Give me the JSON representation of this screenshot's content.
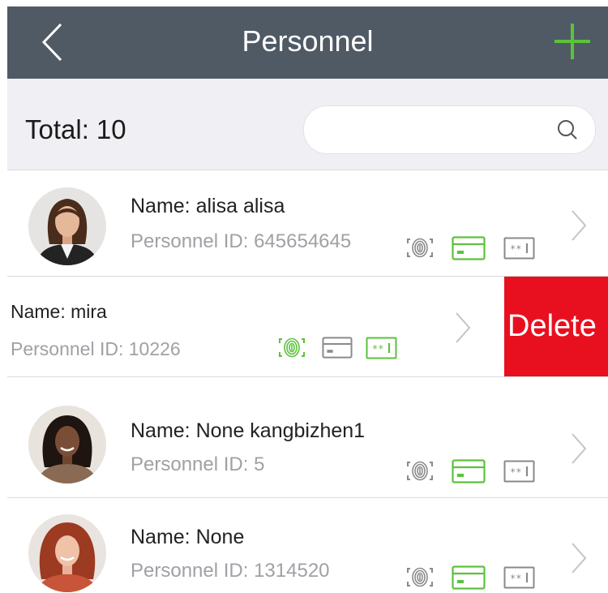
{
  "header": {
    "title": "Personnel",
    "back_icon": "chevron-left-icon",
    "add_icon": "plus-icon"
  },
  "summary": {
    "total_label": "Total:",
    "total_count": "10"
  },
  "search": {
    "placeholder": "",
    "value": "",
    "icon": "search-icon"
  },
  "colors": {
    "nav_bg": "#4f5a65",
    "accent_green": "#5cc23c",
    "delete_red": "#e8101f",
    "muted_text": "#a0a0a6"
  },
  "personnel": [
    {
      "name": "Name: alisa alisa",
      "personnel_id": "Personnel ID: 645654645",
      "fingerprint": "inactive",
      "card": "active",
      "password": "inactive"
    },
    {
      "name": "Name: mira",
      "personnel_id": "Personnel ID: 10226",
      "fingerprint": "active",
      "card": "inactive",
      "password": "active",
      "delete_label": "Delete"
    },
    {
      "name": "Name: None kangbizhen1",
      "personnel_id": "Personnel ID: 5",
      "fingerprint": "inactive",
      "card": "active",
      "password": "inactive"
    },
    {
      "name": "Name: None",
      "personnel_id": "Personnel ID: 1314520",
      "fingerprint": "inactive",
      "card": "active",
      "password": "inactive"
    }
  ]
}
